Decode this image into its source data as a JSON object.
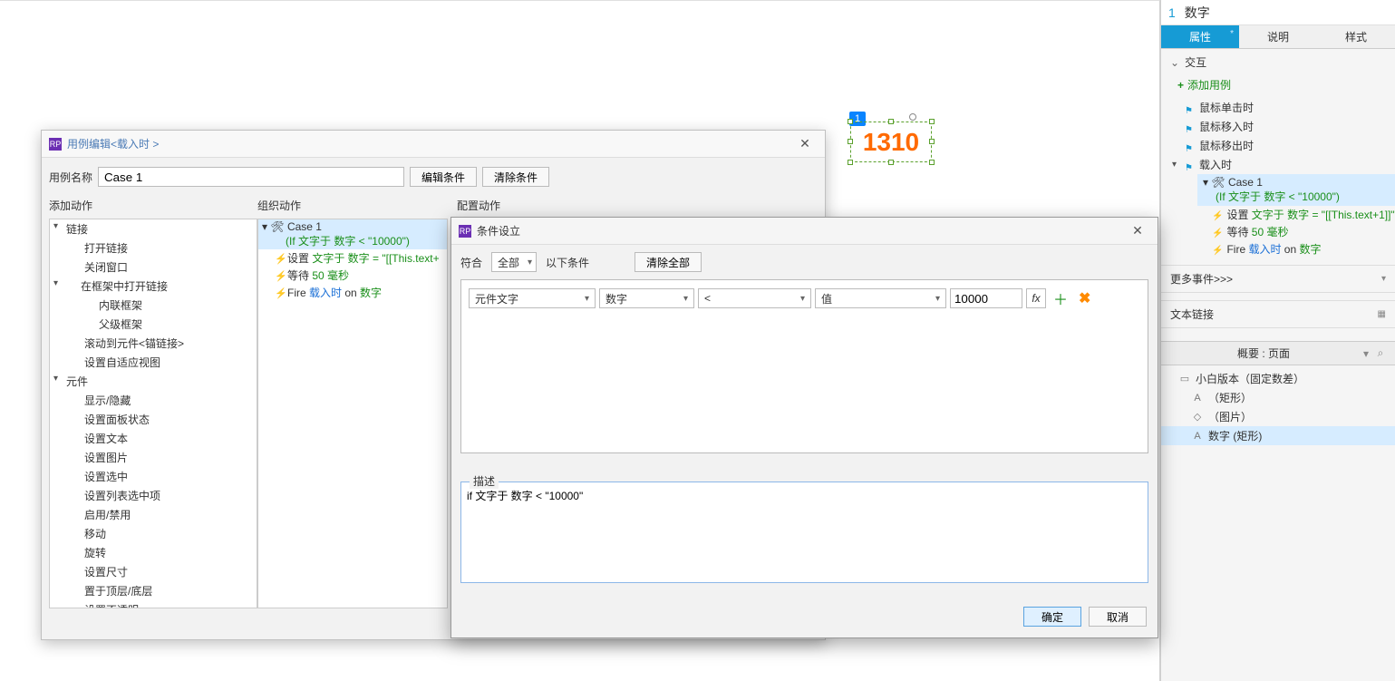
{
  "canvas": {
    "text": "1310",
    "badge": "1"
  },
  "caseDialog": {
    "title": "用例编辑<载入时 >",
    "nameLabel": "用例名称",
    "nameValue": "Case 1",
    "editCondBtn": "编辑条件",
    "clearCondBtn": "清除条件",
    "colA": "添加动作",
    "colB": "组织动作",
    "colC": "配置动作",
    "treeA": {
      "n0": "链接",
      "n0_0": "打开链接",
      "n0_1": "关闭窗口",
      "n0_2": "在框架中打开链接",
      "n0_2_0": "内联框架",
      "n0_2_1": "父级框架",
      "n0_3": "滚动到元件<锚链接>",
      "n0_4": "设置自适应视图",
      "n1": "元件",
      "n1_0": "显示/隐藏",
      "n1_1": "设置面板状态",
      "n1_2": "设置文本",
      "n1_3": "设置图片",
      "n1_4": "设置选中",
      "n1_5": "设置列表选中项",
      "n1_6": "启用/禁用",
      "n1_7": "移动",
      "n1_8": "旋转",
      "n1_9": "设置尺寸",
      "n1_10": "置于顶层/底层",
      "n1_11": "设置不透明"
    },
    "case": {
      "name": "Case 1",
      "cond": "(If 文字于 数字 < \"10000\")",
      "a0_pre": "设置 ",
      "a0_g": "文字于 数字 = \"[[This.text+",
      "a1_pre": "等待 ",
      "a1_g": "50 毫秒",
      "a2_pre": "Fire ",
      "a2_b": "载入时",
      "a2_mid": " on ",
      "a2_g": "数字"
    }
  },
  "condDialog": {
    "title": "条件设立",
    "matchLabel": "符合",
    "matchSel": "全部",
    "matchTail": "以下条件",
    "clearBtn": "清除全部",
    "row": {
      "sel0": "元件文字",
      "sel1": "数字",
      "sel2": "<",
      "sel3": "值",
      "val": "10000",
      "fx": "fx"
    },
    "descLabel": "描述",
    "descText": "if 文字于 数字 < \"10000\"",
    "ok": "确定",
    "cancel": "取消"
  },
  "right": {
    "page": "1",
    "widget": "数字",
    "tab0": "属性",
    "tab1": "说明",
    "tab2": "样式",
    "sec": "交互",
    "addCase": "添加用例",
    "evtClick": "鼠标单击时",
    "evtEnter": "鼠标移入时",
    "evtLeave": "鼠标移出时",
    "evtLoad": "载入时",
    "caseName": "Case 1",
    "caseCond": "(If 文字于 数字 < \"10000\")",
    "act0_pre": "设置 ",
    "act0_g": "文字于 数字 = \"[[This.text+1]]\"",
    "act1_pre": "等待 ",
    "act1_g": "50 毫秒",
    "act2_pre": "Fire ",
    "act2_b": "载入时",
    "act2_mid": " on ",
    "act2_g": "数字",
    "more": "更多事件>>>",
    "textLink": "文本链接",
    "outlineTitle": "概要 : 页面",
    "o0": "小白版本（固定数差）",
    "o1": "（矩形）",
    "o2": "（图片）",
    "o3": "数字 (矩形)"
  }
}
